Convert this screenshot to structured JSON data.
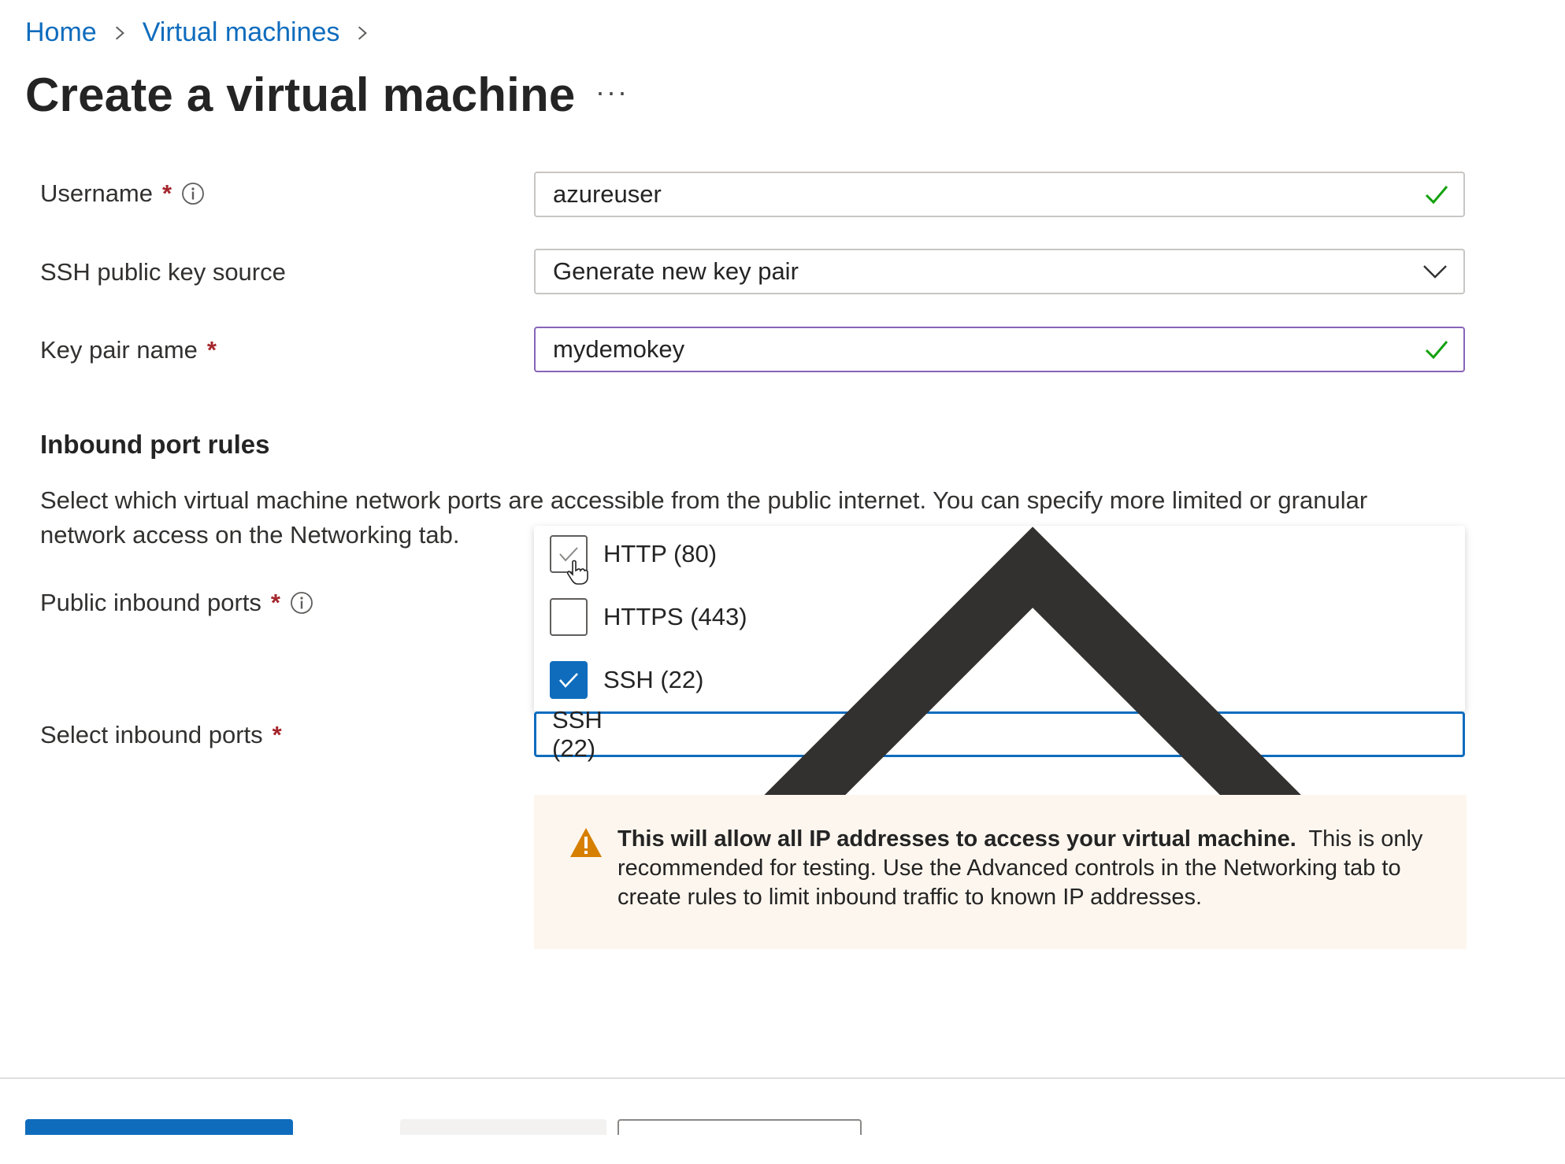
{
  "breadcrumb": {
    "home": "Home",
    "vms": "Virtual machines"
  },
  "page": {
    "title": "Create a virtual machine",
    "more": "···"
  },
  "form": {
    "username": {
      "label": "Username",
      "required": "*",
      "value": "azureuser"
    },
    "ssh_source": {
      "label": "SSH public key source",
      "value": "Generate new key pair"
    },
    "key_pair": {
      "label": "Key pair name",
      "required": "*",
      "value": "mydemokey"
    }
  },
  "inbound": {
    "title": "Inbound port rules",
    "description": "Select which virtual machine network ports are accessible from the public internet. You can specify more limited or granular network access on the Networking tab.",
    "public_ports": {
      "label": "Public inbound ports",
      "required": "*"
    },
    "select_ports": {
      "label": "Select inbound ports",
      "required": "*",
      "value": "SSH (22)"
    },
    "options": [
      {
        "label": "HTTP (80)",
        "checked": false
      },
      {
        "label": "HTTPS (443)",
        "checked": false
      },
      {
        "label": "SSH (22)",
        "checked": true
      }
    ]
  },
  "warning": {
    "bold": "This will allow all IP addresses to access your virtual machine.",
    "text": "This is only recommended for testing.  Use the Advanced controls in the Networking tab to create rules to limit inbound traffic to known IP addresses."
  },
  "colors": {
    "accent": "#0f6cbd",
    "success": "#13a10e",
    "required": "#a4262c",
    "warning_bg": "#fdf6ee",
    "warning_icon": "#d67f00"
  }
}
